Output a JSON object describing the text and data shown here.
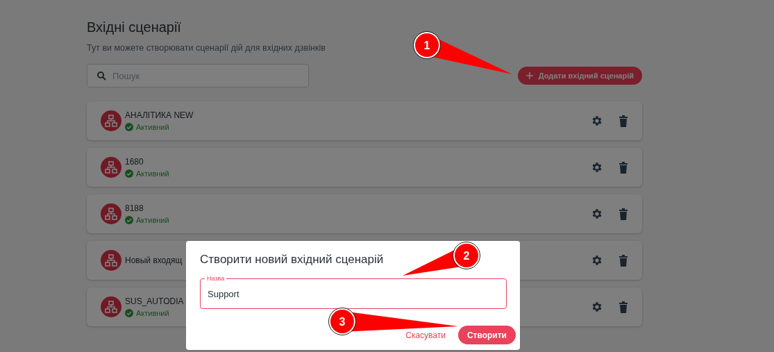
{
  "page": {
    "title": "Вхідні сценарії",
    "subtitle": "Тут ви можете створювати сценарії дій для вхідних дзвінків"
  },
  "search": {
    "placeholder": "Пошук"
  },
  "add_button": {
    "label": "Додати вхідний сценарій"
  },
  "scenarios": [
    {
      "name": "АНАЛІТИКА NEW",
      "status": "Активний"
    },
    {
      "name": "1680",
      "status": "Активний"
    },
    {
      "name": "8188",
      "status": "Активний"
    },
    {
      "name": "Новый входящ"
    },
    {
      "name": "SUS_AUTODIA",
      "status": "Активний"
    }
  ],
  "dialog": {
    "title": "Створити новий вхідний сценарій",
    "field": {
      "label": "Назва",
      "value": "Support"
    },
    "buttons": [
      {
        "label": "Скасувати",
        "kind": "text"
      },
      {
        "label": "Створити",
        "kind": "primary"
      }
    ]
  },
  "callouts": [
    {
      "label": "1"
    },
    {
      "label": "2"
    },
    {
      "label": "3"
    }
  ]
}
